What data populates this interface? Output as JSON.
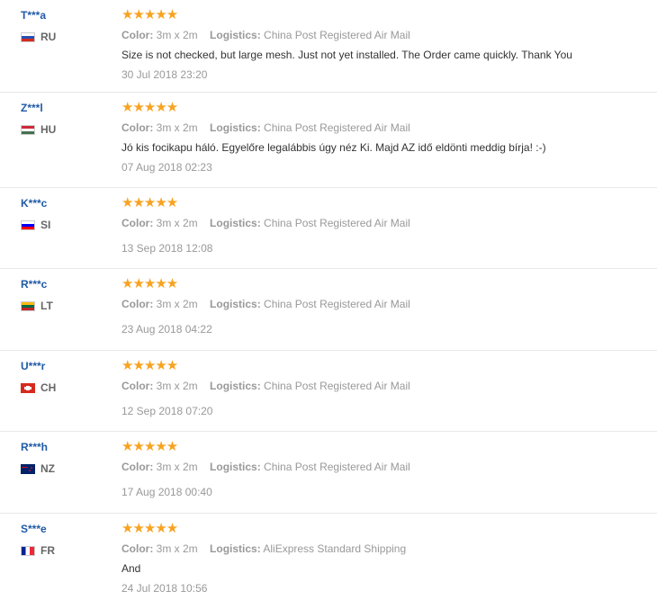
{
  "reviews": [
    {
      "user": "T***a",
      "country": "RU",
      "flag": "ru-flag-icon",
      "stars": "★★★★★",
      "color_label": "Color:",
      "color": "3m x 2m",
      "logistics_label": "Logistics:",
      "logistics": "China Post Registered Air Mail",
      "text": "Size is not checked, but large mesh. Just not yet installed. The Order came quickly. Thank You",
      "date": "30 Jul 2018 23:20"
    },
    {
      "user": "Z***l",
      "country": "HU",
      "flag": "hu-flag-icon",
      "stars": "★★★★★",
      "color_label": "Color:",
      "color": "3m x 2m",
      "logistics_label": "Logistics:",
      "logistics": "China Post Registered Air Mail",
      "text": "Jó kis focikapu háló. Egyelőre legalábbis úgy néz Ki. Majd AZ idő eldönti meddig bírja! :-)",
      "date": "07 Aug 2018 02:23"
    },
    {
      "user": "K***c",
      "country": "SI",
      "flag": "si-flag-icon",
      "stars": "★★★★★",
      "color_label": "Color:",
      "color": "3m x 2m",
      "logistics_label": "Logistics:",
      "logistics": "China Post Registered Air Mail",
      "text": "",
      "date": "13 Sep 2018 12:08"
    },
    {
      "user": "R***c",
      "country": "LT",
      "flag": "lt-flag-icon",
      "stars": "★★★★★",
      "color_label": "Color:",
      "color": "3m x 2m",
      "logistics_label": "Logistics:",
      "logistics": "China Post Registered Air Mail",
      "text": "",
      "date": "23 Aug 2018 04:22"
    },
    {
      "user": "U***r",
      "country": "CH",
      "flag": "ch-flag-icon",
      "stars": "★★★★★",
      "color_label": "Color:",
      "color": "3m x 2m",
      "logistics_label": "Logistics:",
      "logistics": "China Post Registered Air Mail",
      "text": "",
      "date": "12 Sep 2018 07:20"
    },
    {
      "user": "R***h",
      "country": "NZ",
      "flag": "nz-flag-icon",
      "stars": "★★★★★",
      "color_label": "Color:",
      "color": "3m x 2m",
      "logistics_label": "Logistics:",
      "logistics": "China Post Registered Air Mail",
      "text": "",
      "date": "17 Aug 2018 00:40"
    },
    {
      "user": "S***e",
      "country": "FR",
      "flag": "fr-flag-icon",
      "stars": "★★★★★",
      "color_label": "Color:",
      "color": "3m x 2m",
      "logistics_label": "Logistics:",
      "logistics": "AliExpress Standard Shipping",
      "text": "And",
      "date": "24 Jul 2018 10:56"
    }
  ]
}
